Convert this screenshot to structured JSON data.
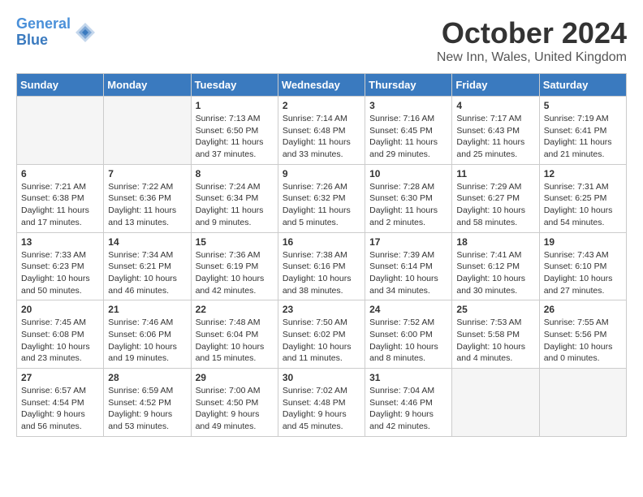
{
  "header": {
    "logo_line1": "General",
    "logo_line2": "Blue",
    "month": "October 2024",
    "location": "New Inn, Wales, United Kingdom"
  },
  "days_of_week": [
    "Sunday",
    "Monday",
    "Tuesday",
    "Wednesday",
    "Thursday",
    "Friday",
    "Saturday"
  ],
  "weeks": [
    [
      {
        "day": "",
        "text": ""
      },
      {
        "day": "",
        "text": ""
      },
      {
        "day": "1",
        "text": "Sunrise: 7:13 AM\nSunset: 6:50 PM\nDaylight: 11 hours\nand 37 minutes."
      },
      {
        "day": "2",
        "text": "Sunrise: 7:14 AM\nSunset: 6:48 PM\nDaylight: 11 hours\nand 33 minutes."
      },
      {
        "day": "3",
        "text": "Sunrise: 7:16 AM\nSunset: 6:45 PM\nDaylight: 11 hours\nand 29 minutes."
      },
      {
        "day": "4",
        "text": "Sunrise: 7:17 AM\nSunset: 6:43 PM\nDaylight: 11 hours\nand 25 minutes."
      },
      {
        "day": "5",
        "text": "Sunrise: 7:19 AM\nSunset: 6:41 PM\nDaylight: 11 hours\nand 21 minutes."
      }
    ],
    [
      {
        "day": "6",
        "text": "Sunrise: 7:21 AM\nSunset: 6:38 PM\nDaylight: 11 hours\nand 17 minutes."
      },
      {
        "day": "7",
        "text": "Sunrise: 7:22 AM\nSunset: 6:36 PM\nDaylight: 11 hours\nand 13 minutes."
      },
      {
        "day": "8",
        "text": "Sunrise: 7:24 AM\nSunset: 6:34 PM\nDaylight: 11 hours\nand 9 minutes."
      },
      {
        "day": "9",
        "text": "Sunrise: 7:26 AM\nSunset: 6:32 PM\nDaylight: 11 hours\nand 5 minutes."
      },
      {
        "day": "10",
        "text": "Sunrise: 7:28 AM\nSunset: 6:30 PM\nDaylight: 11 hours\nand 2 minutes."
      },
      {
        "day": "11",
        "text": "Sunrise: 7:29 AM\nSunset: 6:27 PM\nDaylight: 10 hours\nand 58 minutes."
      },
      {
        "day": "12",
        "text": "Sunrise: 7:31 AM\nSunset: 6:25 PM\nDaylight: 10 hours\nand 54 minutes."
      }
    ],
    [
      {
        "day": "13",
        "text": "Sunrise: 7:33 AM\nSunset: 6:23 PM\nDaylight: 10 hours\nand 50 minutes."
      },
      {
        "day": "14",
        "text": "Sunrise: 7:34 AM\nSunset: 6:21 PM\nDaylight: 10 hours\nand 46 minutes."
      },
      {
        "day": "15",
        "text": "Sunrise: 7:36 AM\nSunset: 6:19 PM\nDaylight: 10 hours\nand 42 minutes."
      },
      {
        "day": "16",
        "text": "Sunrise: 7:38 AM\nSunset: 6:16 PM\nDaylight: 10 hours\nand 38 minutes."
      },
      {
        "day": "17",
        "text": "Sunrise: 7:39 AM\nSunset: 6:14 PM\nDaylight: 10 hours\nand 34 minutes."
      },
      {
        "day": "18",
        "text": "Sunrise: 7:41 AM\nSunset: 6:12 PM\nDaylight: 10 hours\nand 30 minutes."
      },
      {
        "day": "19",
        "text": "Sunrise: 7:43 AM\nSunset: 6:10 PM\nDaylight: 10 hours\nand 27 minutes."
      }
    ],
    [
      {
        "day": "20",
        "text": "Sunrise: 7:45 AM\nSunset: 6:08 PM\nDaylight: 10 hours\nand 23 minutes."
      },
      {
        "day": "21",
        "text": "Sunrise: 7:46 AM\nSunset: 6:06 PM\nDaylight: 10 hours\nand 19 minutes."
      },
      {
        "day": "22",
        "text": "Sunrise: 7:48 AM\nSunset: 6:04 PM\nDaylight: 10 hours\nand 15 minutes."
      },
      {
        "day": "23",
        "text": "Sunrise: 7:50 AM\nSunset: 6:02 PM\nDaylight: 10 hours\nand 11 minutes."
      },
      {
        "day": "24",
        "text": "Sunrise: 7:52 AM\nSunset: 6:00 PM\nDaylight: 10 hours\nand 8 minutes."
      },
      {
        "day": "25",
        "text": "Sunrise: 7:53 AM\nSunset: 5:58 PM\nDaylight: 10 hours\nand 4 minutes."
      },
      {
        "day": "26",
        "text": "Sunrise: 7:55 AM\nSunset: 5:56 PM\nDaylight: 10 hours\nand 0 minutes."
      }
    ],
    [
      {
        "day": "27",
        "text": "Sunrise: 6:57 AM\nSunset: 4:54 PM\nDaylight: 9 hours\nand 56 minutes."
      },
      {
        "day": "28",
        "text": "Sunrise: 6:59 AM\nSunset: 4:52 PM\nDaylight: 9 hours\nand 53 minutes."
      },
      {
        "day": "29",
        "text": "Sunrise: 7:00 AM\nSunset: 4:50 PM\nDaylight: 9 hours\nand 49 minutes."
      },
      {
        "day": "30",
        "text": "Sunrise: 7:02 AM\nSunset: 4:48 PM\nDaylight: 9 hours\nand 45 minutes."
      },
      {
        "day": "31",
        "text": "Sunrise: 7:04 AM\nSunset: 4:46 PM\nDaylight: 9 hours\nand 42 minutes."
      },
      {
        "day": "",
        "text": ""
      },
      {
        "day": "",
        "text": ""
      }
    ]
  ]
}
